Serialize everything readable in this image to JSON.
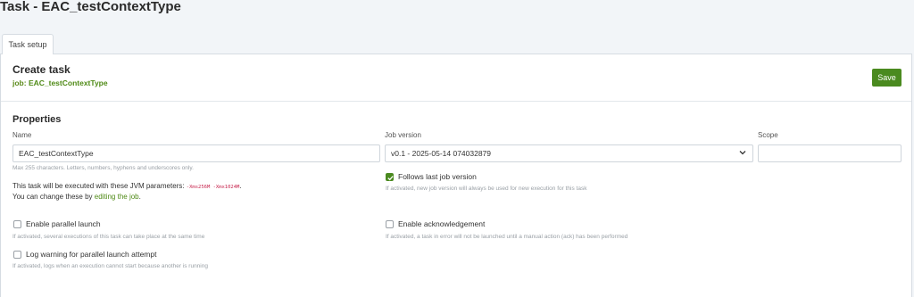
{
  "page": {
    "title": "Task - EAC_testContextType"
  },
  "tabs": [
    {
      "label": "Task setup"
    }
  ],
  "header": {
    "title": "Create task",
    "job_label": "job:",
    "job_name": "EAC_testContextType",
    "save_label": "Save"
  },
  "properties": {
    "title": "Properties",
    "name": {
      "label": "Name",
      "value": "EAC_testContextType",
      "help": "Max 255 characters. Letters, numbers, hyphens and underscores only."
    },
    "job_version": {
      "label": "Job version",
      "value": "v0.1 - 2025-05-14 074032879"
    },
    "scope": {
      "label": "Scope",
      "value": ""
    },
    "follows_last": {
      "label": "Follows last job version",
      "checked": true,
      "help": "If activated, new job version will always be used for new execution for this task"
    },
    "jvm": {
      "text_before": "This task will be executed with these JVM parameters:",
      "params": "-Xms256M -Xmx1024M",
      "text_after": ".",
      "change_before": "You can change these by",
      "change_link": "editing the job",
      "change_after": "."
    },
    "parallel": {
      "label": "Enable parallel launch",
      "checked": false,
      "help": "If activated, several executions of this task can take place at the same time"
    },
    "acknowledgement": {
      "label": "Enable acknowledgement",
      "checked": false,
      "help": "If activated, a task in error will not be launched until a manual action (ack) has been performed"
    },
    "log_warning": {
      "label": "Log warning for parallel launch attempt",
      "checked": false,
      "help": "If activated, logs when an execution cannot start because another is running"
    }
  },
  "colors": {
    "accent": "#4a8a1f",
    "link": "#4f8a16",
    "code": "#c7254e"
  },
  "icons": {
    "select": "chevron-down-icon",
    "checkbox": "checkmark-icon"
  }
}
